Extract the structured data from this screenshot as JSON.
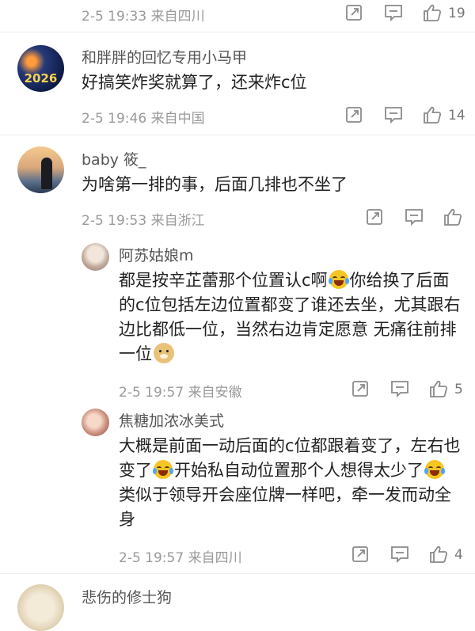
{
  "comments": [
    {
      "meta": "2-5 19:33  来自四川",
      "like_count": "19"
    },
    {
      "username": "和胖胖的回忆专用小马甲",
      "text": "好搞笑炸奖就算了，还来炸c位",
      "meta": "2-5 19:46  来自中国",
      "like_count": "14",
      "avatar_label": "2026"
    },
    {
      "username": "baby 筱_",
      "text": "为啥第一排的事，后面几排也不坐了",
      "meta": "2-5 19:53  来自浙江",
      "like_count": ""
    }
  ],
  "replies": [
    {
      "username": "阿苏姑娘m",
      "text_1": "都是按辛芷蕾那个位置认c啊",
      "text_2": "你给换了后面的c位包括左边位置都变了谁还去坐，尤其跟右边比都低一位，当然右边肯定愿意 无痛往前排一位",
      "meta": "2-5 19:57  来自安徽",
      "like_count": "5"
    },
    {
      "username": "焦糖加浓冰美式",
      "text_1": "大概是前面一动后面的c位都跟着变了，左右也变了",
      "text_2": "开始私自动位置那个人想得太少了",
      "text_3": "类似于领导开会座位牌一样吧，牵一发而动全身",
      "meta": "2-5 19:57  来自四川",
      "like_count": "4"
    }
  ],
  "next": {
    "username": "悲伤的修士狗"
  },
  "colors": {
    "meta": "#9a9a9a",
    "name": "#555555",
    "text": "#222222",
    "divider": "#ececec"
  },
  "icons": [
    "share-icon",
    "comment-icon",
    "like-icon"
  ]
}
